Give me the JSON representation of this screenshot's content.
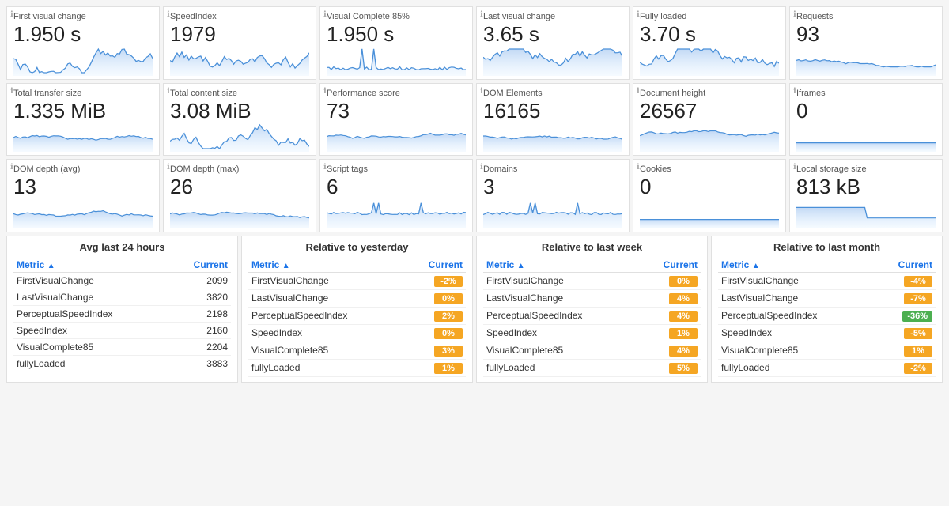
{
  "rows": [
    {
      "cards": [
        {
          "id": "first-visual-change",
          "title": "First visual change",
          "value": "1.950 s",
          "hasChart": true,
          "chartType": "noisy"
        },
        {
          "id": "speed-index",
          "title": "SpeedIndex",
          "value": "1979",
          "hasChart": true,
          "chartType": "noisy"
        },
        {
          "id": "visual-complete-85",
          "title": "Visual Complete 85%",
          "value": "1.950 s",
          "hasChart": true,
          "chartType": "spiky"
        },
        {
          "id": "last-visual-change",
          "title": "Last visual change",
          "value": "3.65 s",
          "hasChart": true,
          "chartType": "noisy"
        },
        {
          "id": "fully-loaded",
          "title": "Fully loaded",
          "value": "3.70 s",
          "hasChart": true,
          "chartType": "noisy"
        },
        {
          "id": "requests",
          "title": "Requests",
          "value": "93",
          "hasChart": true,
          "chartType": "flat"
        }
      ]
    },
    {
      "cards": [
        {
          "id": "total-transfer-size",
          "title": "Total transfer size",
          "value": "1.335 MiB",
          "hasChart": true,
          "chartType": "flat"
        },
        {
          "id": "total-content-size",
          "title": "Total content size",
          "value": "3.08 MiB",
          "hasChart": true,
          "chartType": "noisy"
        },
        {
          "id": "performance-score",
          "title": "Performance score",
          "value": "73",
          "hasChart": true,
          "chartType": "flat"
        },
        {
          "id": "dom-elements",
          "title": "DOM Elements",
          "value": "16165",
          "hasChart": true,
          "chartType": "flat"
        },
        {
          "id": "document-height",
          "title": "Document height",
          "value": "26567",
          "hasChart": true,
          "chartType": "flat"
        },
        {
          "id": "iframes",
          "title": "Iframes",
          "value": "0",
          "hasChart": true,
          "chartType": "line"
        }
      ]
    },
    {
      "cards": [
        {
          "id": "dom-depth-avg",
          "title": "DOM depth (avg)",
          "value": "13",
          "hasChart": true,
          "chartType": "flat"
        },
        {
          "id": "dom-depth-max",
          "title": "DOM depth (max)",
          "value": "26",
          "hasChart": true,
          "chartType": "flat"
        },
        {
          "id": "script-tags",
          "title": "Script tags",
          "value": "6",
          "hasChart": true,
          "chartType": "spiky2"
        },
        {
          "id": "domains",
          "title": "Domains",
          "value": "3",
          "hasChart": true,
          "chartType": "spiky2"
        },
        {
          "id": "cookies",
          "title": "Cookies",
          "value": "0",
          "hasChart": true,
          "chartType": "line"
        },
        {
          "id": "local-storage-size",
          "title": "Local storage size",
          "value": "813 kB",
          "hasChart": true,
          "chartType": "step"
        }
      ]
    }
  ],
  "tables": [
    {
      "id": "avg-last-24h",
      "title": "Avg last 24 hours",
      "col1": "Metric",
      "col2": "Current",
      "rows": [
        {
          "metric": "FirstVisualChange",
          "value": "2099",
          "badge": false
        },
        {
          "metric": "LastVisualChange",
          "value": "3820",
          "badge": false
        },
        {
          "metric": "PerceptualSpeedIndex",
          "value": "2198",
          "badge": false
        },
        {
          "metric": "SpeedIndex",
          "value": "2160",
          "badge": false
        },
        {
          "metric": "VisualComplete85",
          "value": "2204",
          "badge": false
        },
        {
          "metric": "fullyLoaded",
          "value": "3883",
          "badge": false
        }
      ]
    },
    {
      "id": "relative-yesterday",
      "title": "Relative to yesterday",
      "col1": "Metric",
      "col2": "Current",
      "rows": [
        {
          "metric": "FirstVisualChange",
          "value": "-2%",
          "badge": true,
          "color": "orange"
        },
        {
          "metric": "LastVisualChange",
          "value": "0%",
          "badge": true,
          "color": "orange"
        },
        {
          "metric": "PerceptualSpeedIndex",
          "value": "2%",
          "badge": true,
          "color": "orange"
        },
        {
          "metric": "SpeedIndex",
          "value": "0%",
          "badge": true,
          "color": "orange"
        },
        {
          "metric": "VisualComplete85",
          "value": "3%",
          "badge": true,
          "color": "orange"
        },
        {
          "metric": "fullyLoaded",
          "value": "1%",
          "badge": true,
          "color": "orange"
        }
      ]
    },
    {
      "id": "relative-last-week",
      "title": "Relative to last week",
      "col1": "Metric",
      "col2": "Current",
      "rows": [
        {
          "metric": "FirstVisualChange",
          "value": "0%",
          "badge": true,
          "color": "orange"
        },
        {
          "metric": "LastVisualChange",
          "value": "4%",
          "badge": true,
          "color": "orange"
        },
        {
          "metric": "PerceptualSpeedIndex",
          "value": "4%",
          "badge": true,
          "color": "orange"
        },
        {
          "metric": "SpeedIndex",
          "value": "1%",
          "badge": true,
          "color": "orange"
        },
        {
          "metric": "VisualComplete85",
          "value": "4%",
          "badge": true,
          "color": "orange"
        },
        {
          "metric": "fullyLoaded",
          "value": "5%",
          "badge": true,
          "color": "orange"
        }
      ]
    },
    {
      "id": "relative-last-month",
      "title": "Relative to last month",
      "col1": "Metric",
      "col2": "Current",
      "rows": [
        {
          "metric": "FirstVisualChange",
          "value": "-4%",
          "badge": true,
          "color": "orange"
        },
        {
          "metric": "LastVisualChange",
          "value": "-7%",
          "badge": true,
          "color": "orange"
        },
        {
          "metric": "PerceptualSpeedIndex",
          "value": "-36%",
          "badge": true,
          "color": "green"
        },
        {
          "metric": "SpeedIndex",
          "value": "-5%",
          "badge": true,
          "color": "orange"
        },
        {
          "metric": "VisualComplete85",
          "value": "1%",
          "badge": true,
          "color": "orange"
        },
        {
          "metric": "fullyLoaded",
          "value": "-2%",
          "badge": true,
          "color": "orange"
        }
      ]
    }
  ]
}
